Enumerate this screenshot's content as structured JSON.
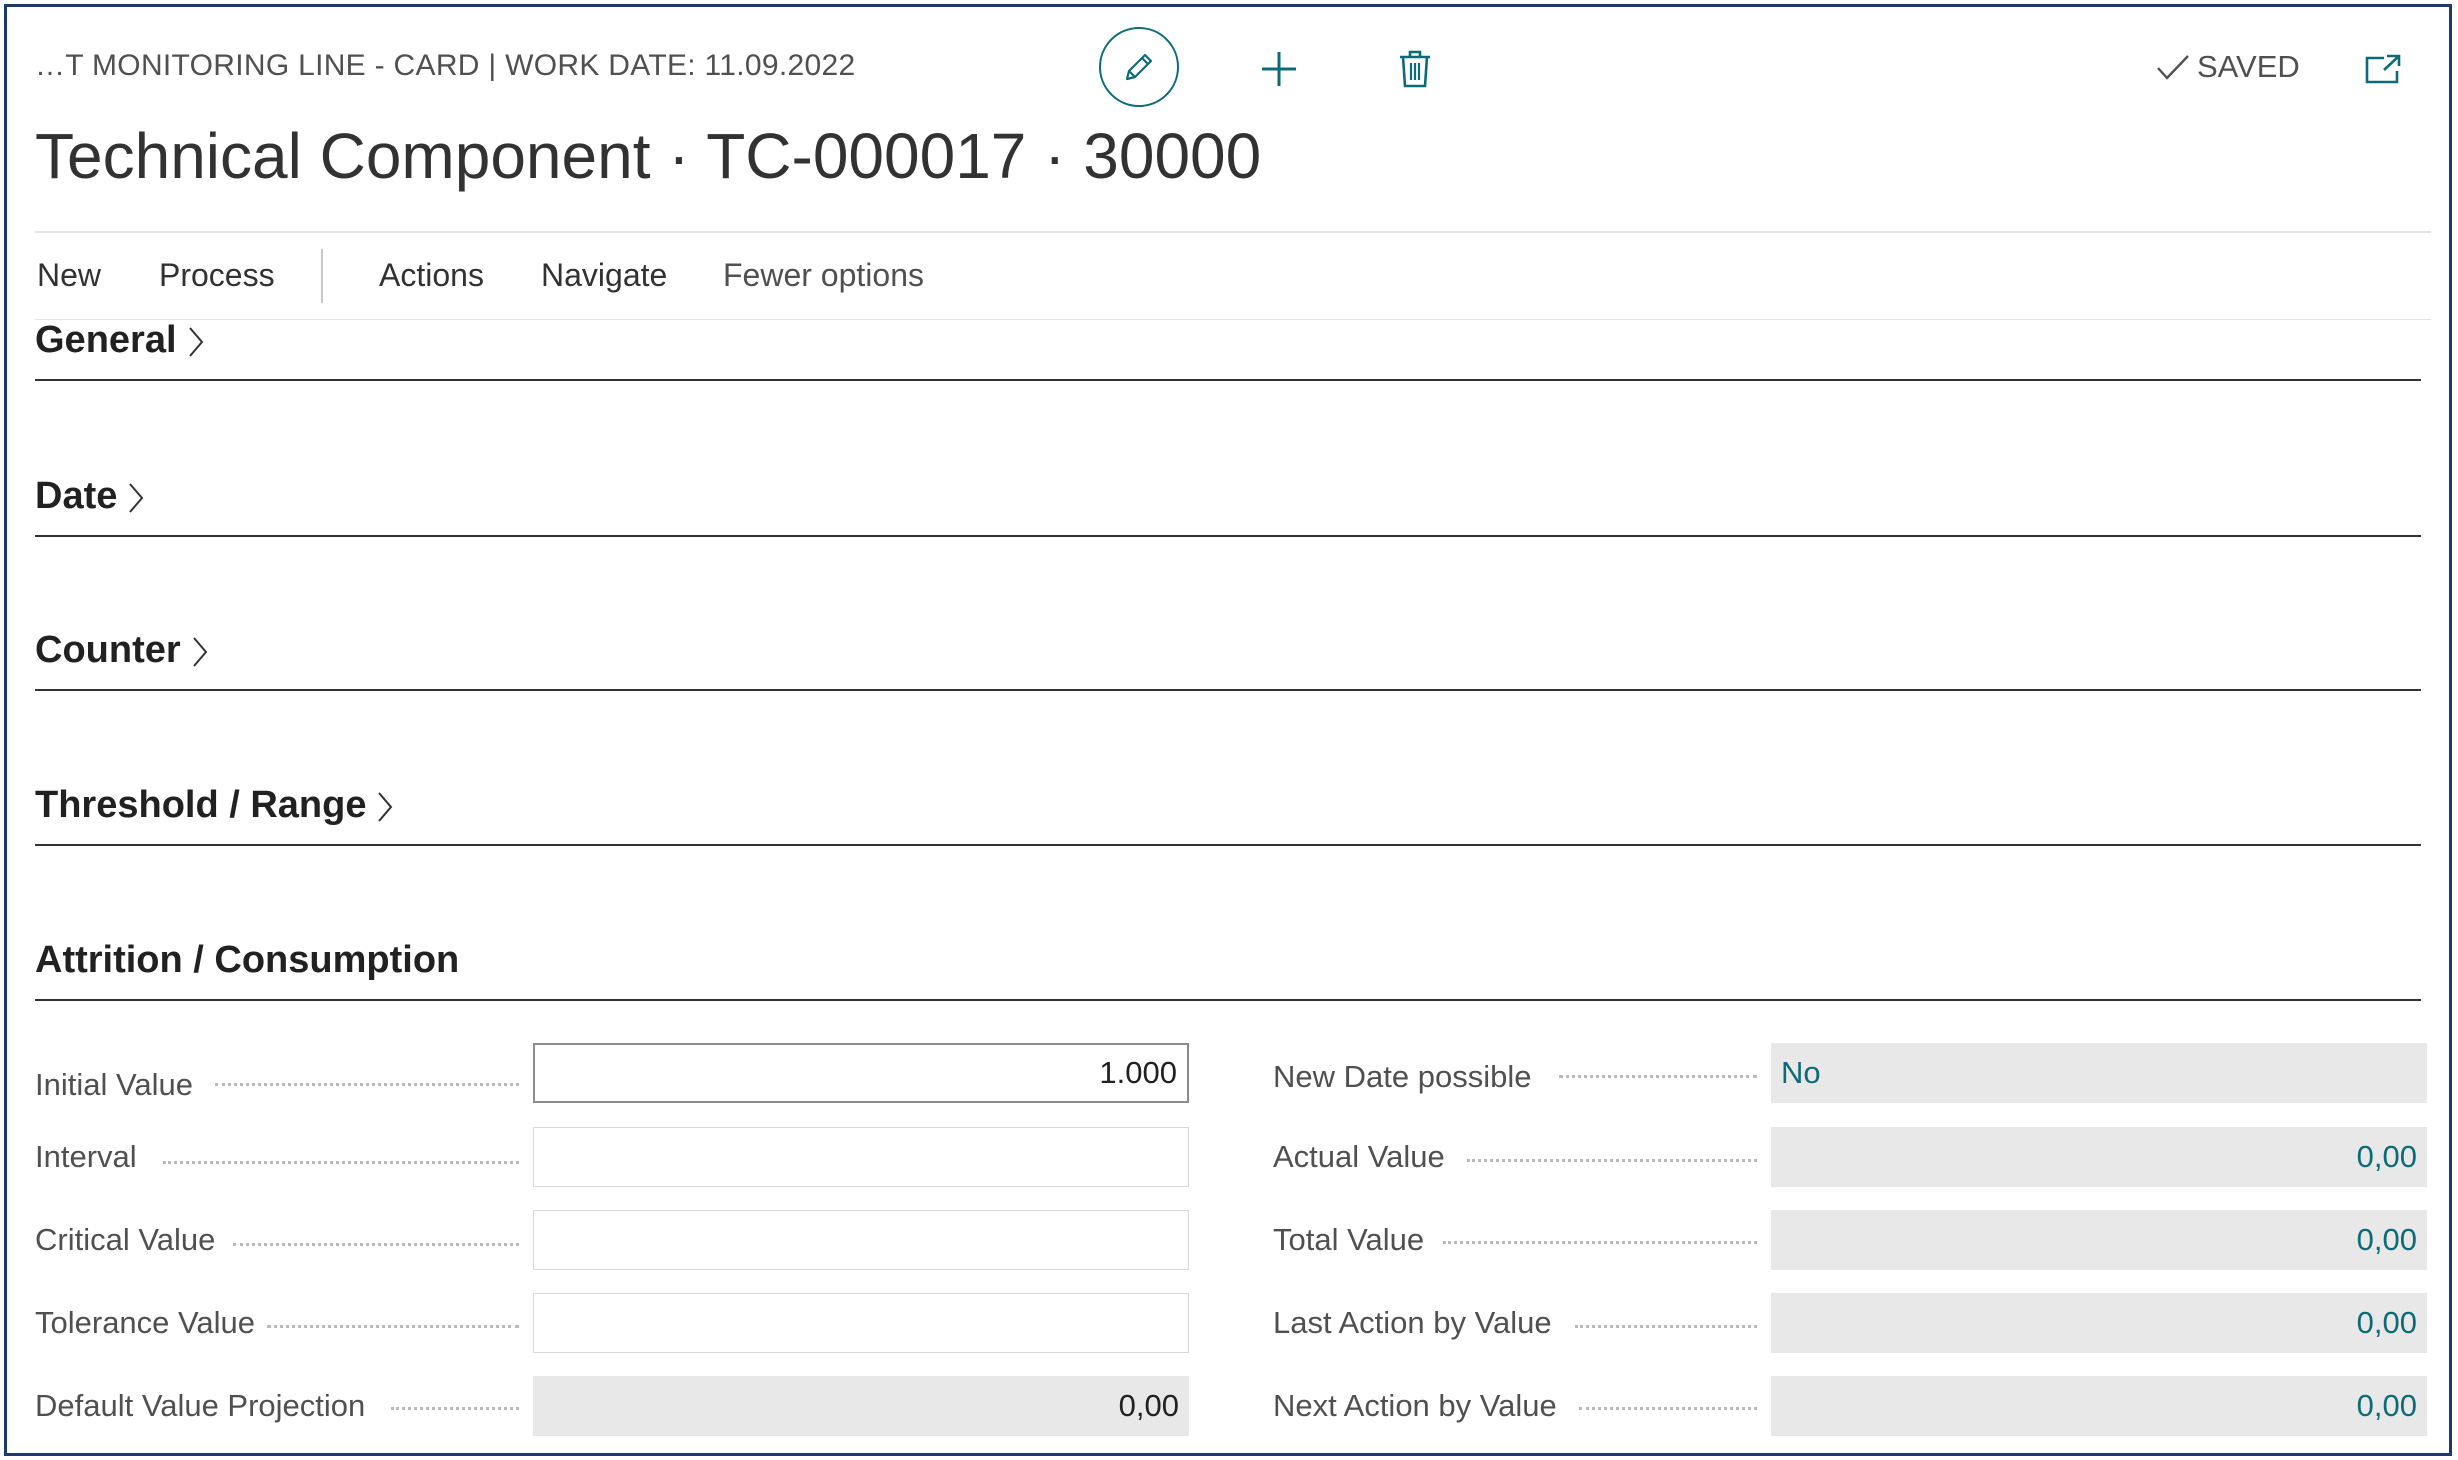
{
  "header": {
    "breadcrumb": "…T MONITORING LINE - CARD | WORK DATE: 11.09.2022",
    "title": "Technical Component · TC-000017 · 30000",
    "status": "SAVED",
    "icons": [
      "edit-pencil-icon",
      "plus-icon",
      "trash-icon",
      "check-icon",
      "open-in-new-window-icon"
    ]
  },
  "actionbar": {
    "new": "New",
    "process": "Process",
    "actions": "Actions",
    "navigate": "Navigate",
    "fewer_options": "Fewer options"
  },
  "fasttabs": {
    "general": "General",
    "date": "Date",
    "counter": "Counter",
    "threshold": "Threshold / Range",
    "attrition": "Attrition / Consumption"
  },
  "fields_left": [
    {
      "label": "Initial Value",
      "value": "1.000"
    },
    {
      "label": "Interval",
      "value": ""
    },
    {
      "label": "Critical Value",
      "value": ""
    },
    {
      "label": "Tolerance Value",
      "value": ""
    },
    {
      "label": "Default Value Projection",
      "value": "0,00"
    }
  ],
  "fields_right": [
    {
      "label": "New Date possible",
      "value": "No"
    },
    {
      "label": "Actual Value",
      "value": "0,00"
    },
    {
      "label": "Total Value",
      "value": "0,00"
    },
    {
      "label": "Last Action by Value",
      "value": "0,00"
    },
    {
      "label": "Next Action by Value",
      "value": "0,00"
    }
  ],
  "colors": {
    "accent": "#0c6b77",
    "border": "#1c3a6a",
    "readonly_bg": "#e8e8e8"
  }
}
